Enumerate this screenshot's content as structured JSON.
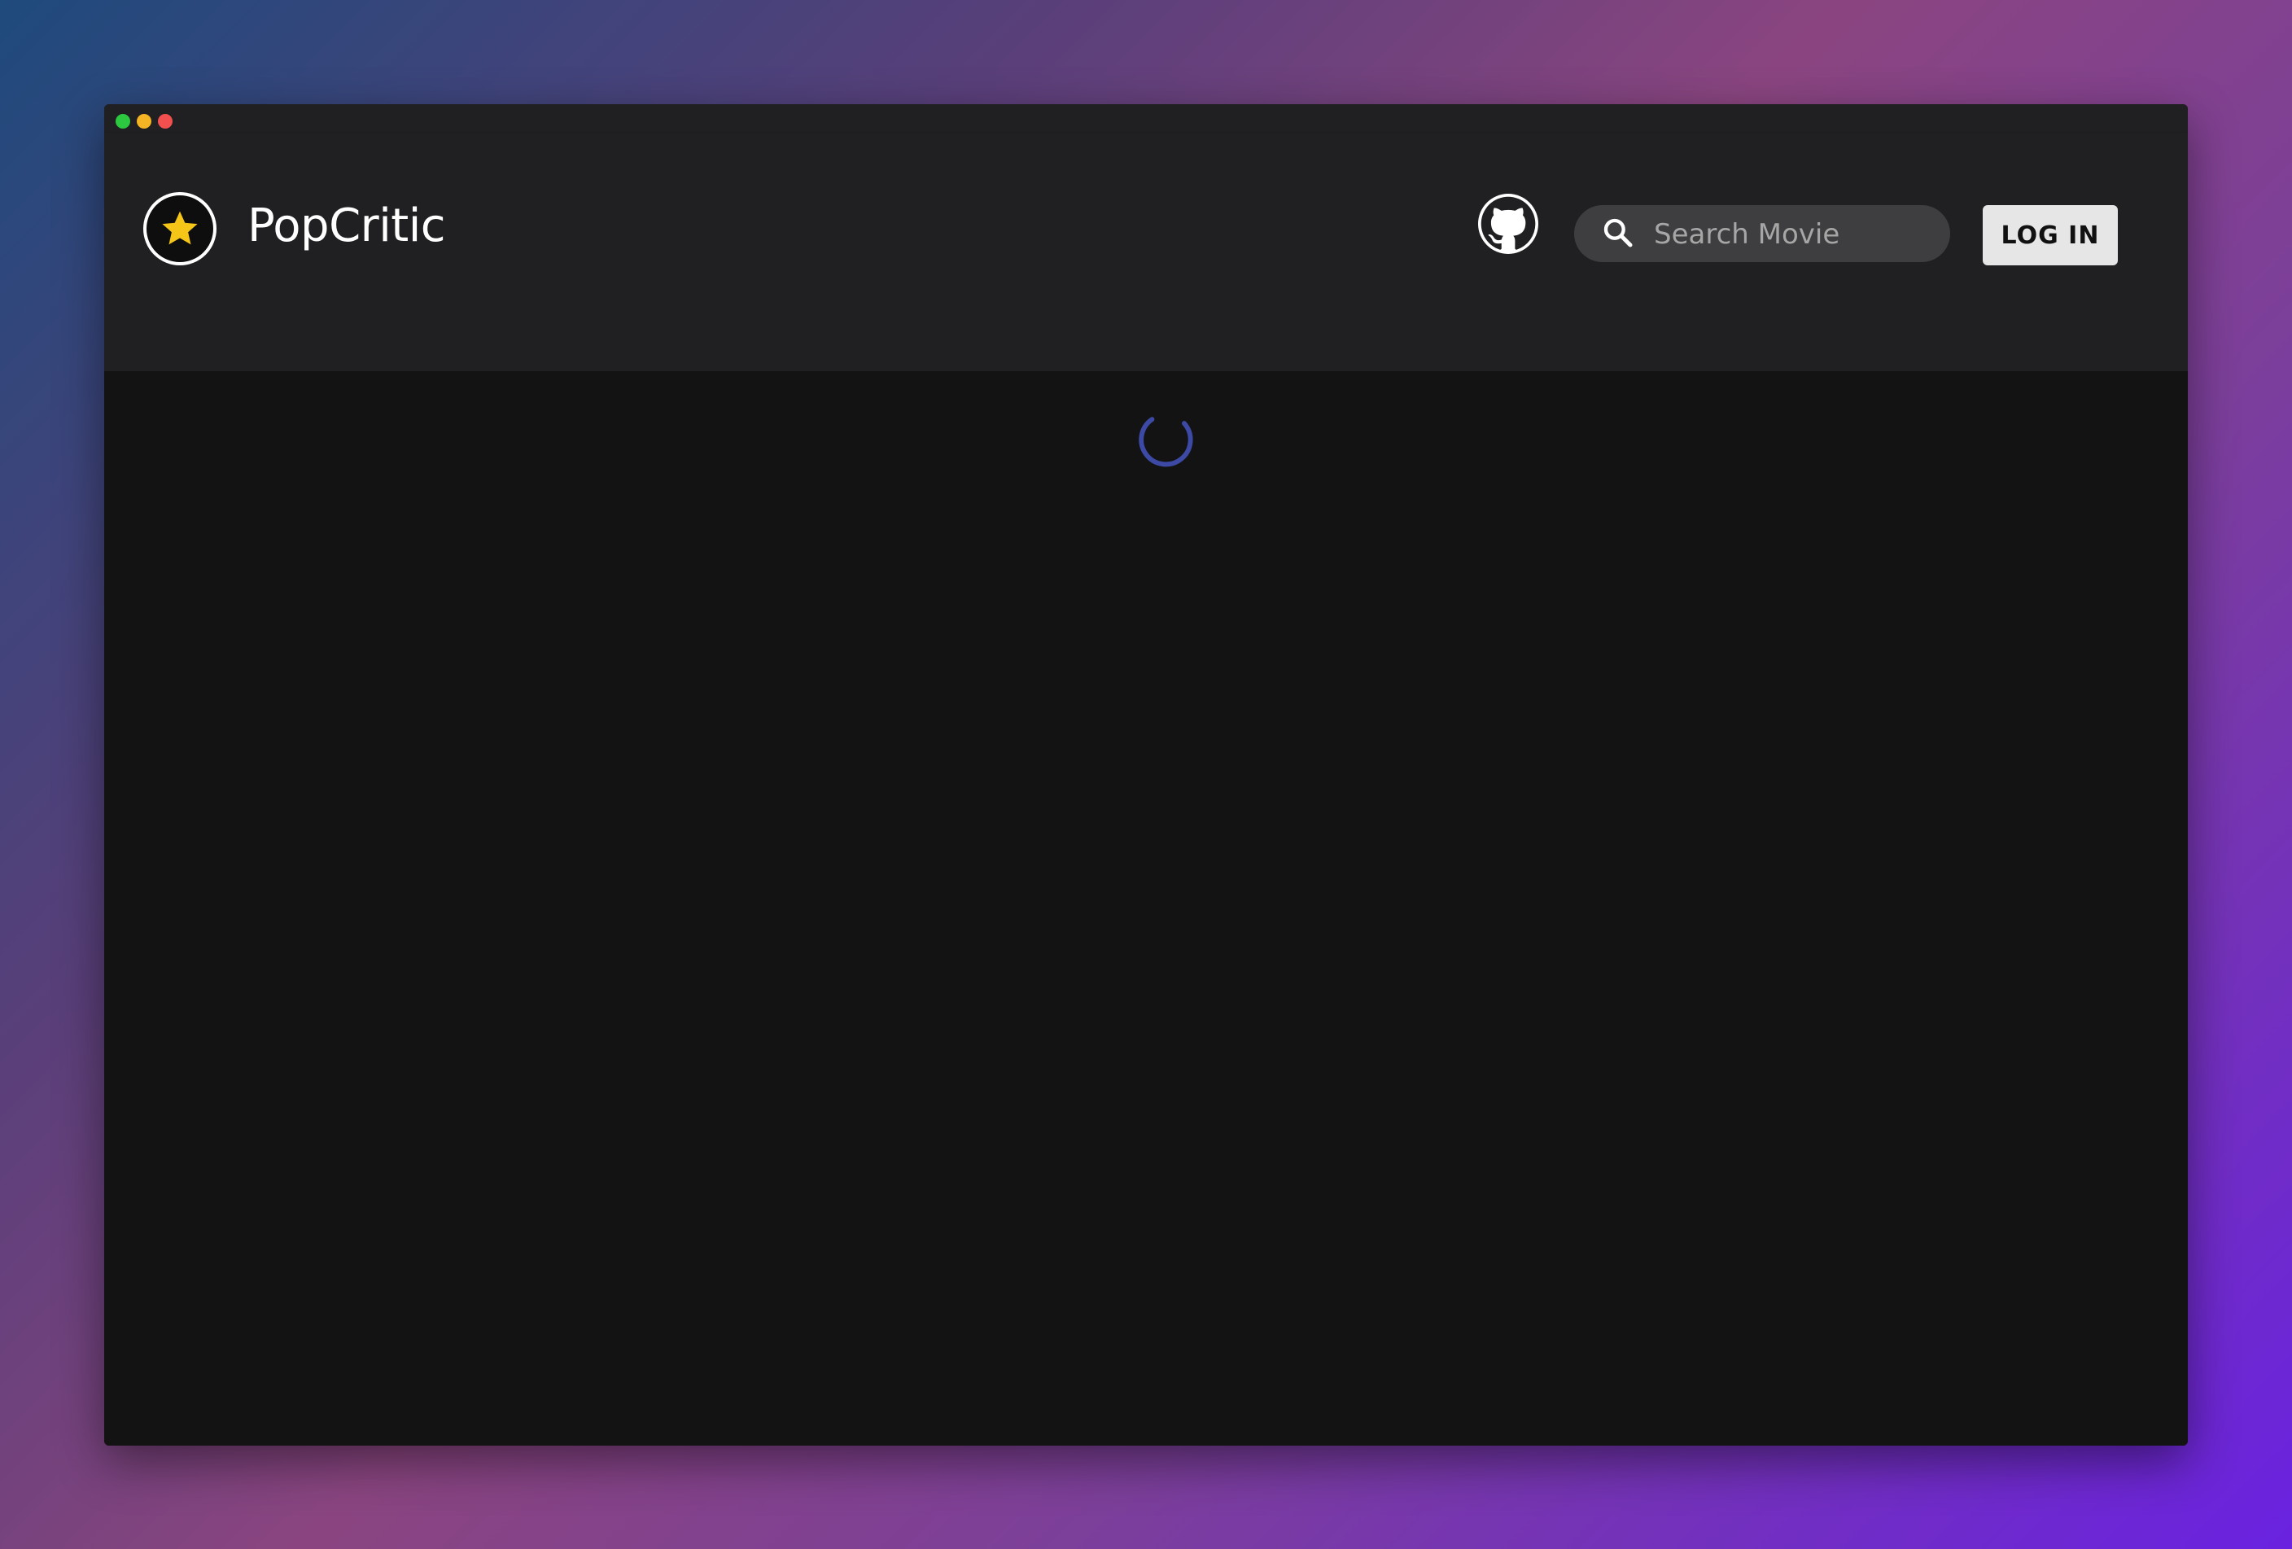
{
  "app": {
    "brand_name": "PopCritic",
    "logo_icon": "star-icon",
    "accent_color": "#f5c518"
  },
  "navbar": {
    "github_icon": "github-icon",
    "search": {
      "placeholder": "Search Movie",
      "value": ""
    },
    "login_label": "LOG IN"
  },
  "main": {
    "loading_indicator": "spinner",
    "spinner_color": "#3d4aa5"
  }
}
